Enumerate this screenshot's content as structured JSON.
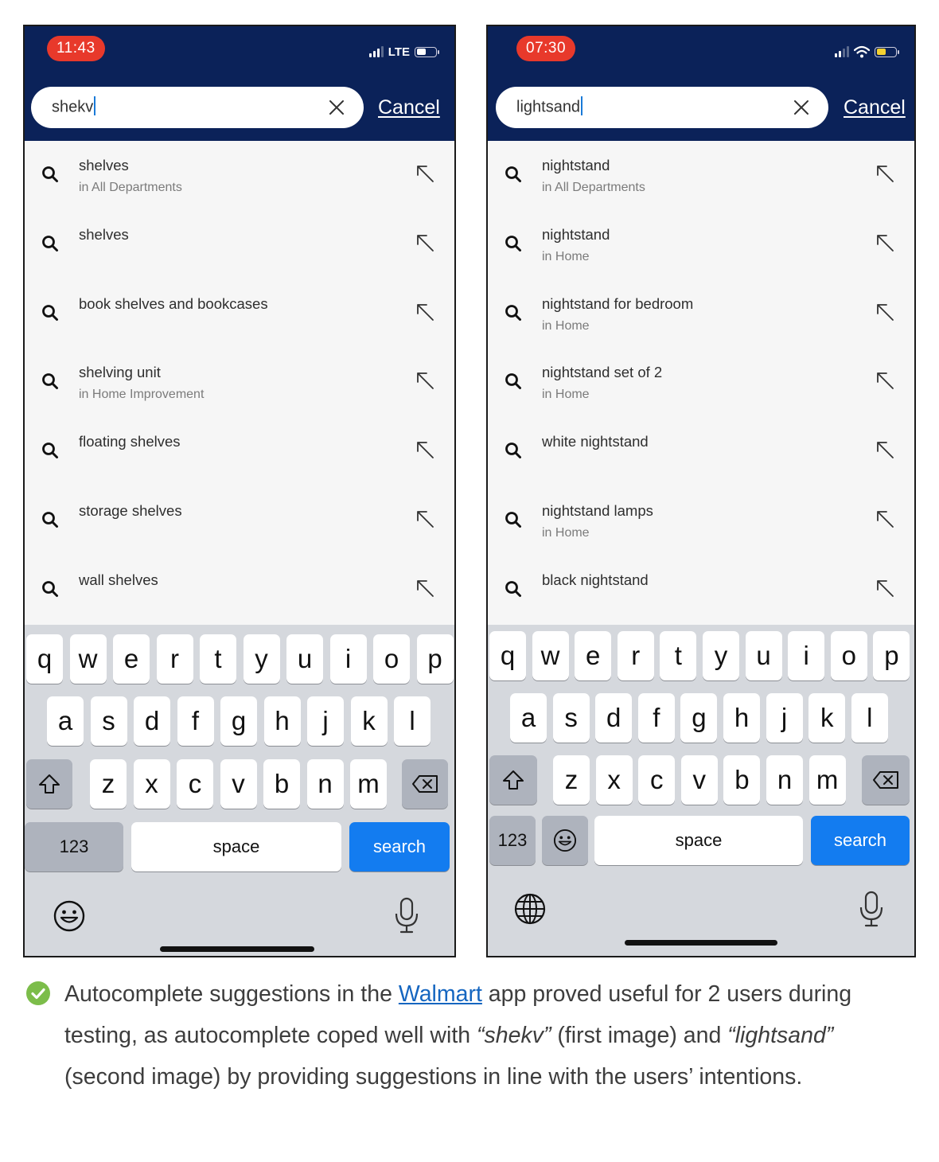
{
  "phones": [
    {
      "status": {
        "time": "11:43",
        "network": "LTE",
        "battery_color": "#ffffff"
      },
      "search": {
        "query": "shekv",
        "cancel_label": "Cancel"
      },
      "suggestions": [
        {
          "title": "shelves",
          "subtitle": "in All Departments"
        },
        {
          "title": "shelves",
          "subtitle": ""
        },
        {
          "title": "book shelves and bookcases",
          "subtitle": ""
        },
        {
          "title": "shelving unit",
          "subtitle": "in Home Improvement"
        },
        {
          "title": "floating shelves",
          "subtitle": ""
        },
        {
          "title": "storage shelves",
          "subtitle": ""
        },
        {
          "title": "wall shelves",
          "subtitle": ""
        }
      ],
      "keyboard": {
        "row1": [
          "q",
          "w",
          "e",
          "r",
          "t",
          "y",
          "u",
          "i",
          "o",
          "p"
        ],
        "row2": [
          "a",
          "s",
          "d",
          "f",
          "g",
          "h",
          "j",
          "k",
          "l"
        ],
        "row3": [
          "z",
          "x",
          "c",
          "v",
          "b",
          "n",
          "m"
        ],
        "numbers_label": "123",
        "space_label": "space",
        "search_label": "search"
      }
    },
    {
      "status": {
        "time": "07:30",
        "network": "",
        "battery_color": "#f3d030"
      },
      "search": {
        "query": "lightsand",
        "cancel_label": "Cancel"
      },
      "suggestions": [
        {
          "title": "nightstand",
          "subtitle": "in All Departments"
        },
        {
          "title": "nightstand",
          "subtitle": "in Home"
        },
        {
          "title": "nightstand for bedroom",
          "subtitle": "in Home"
        },
        {
          "title": "nightstand set of 2",
          "subtitle": "in Home"
        },
        {
          "title": "white nightstand",
          "subtitle": ""
        },
        {
          "title": "nightstand lamps",
          "subtitle": "in Home"
        },
        {
          "title": "black nightstand",
          "subtitle": ""
        }
      ],
      "keyboard": {
        "row1": [
          "q",
          "w",
          "e",
          "r",
          "t",
          "y",
          "u",
          "i",
          "o",
          "p"
        ],
        "row2": [
          "a",
          "s",
          "d",
          "f",
          "g",
          "h",
          "j",
          "k",
          "l"
        ],
        "row3": [
          "z",
          "x",
          "c",
          "v",
          "b",
          "n",
          "m"
        ],
        "numbers_label": "123",
        "space_label": "space",
        "search_label": "search"
      }
    }
  ],
  "caption": {
    "icon": "check-circle-icon",
    "icon_color": "#7cbd4a",
    "part1": "Autocomplete suggestions in the ",
    "link": "Walmart",
    "part2": " app proved useful for 2 users during testing, as autocomplete coped well with ",
    "query1": "“shekv”",
    "part3": " (first image) and ",
    "query2": "“lightsand”",
    "part4": " (second image) by providing suggestions in line with the users’ intentions."
  },
  "colors": {
    "header": "#0b2259",
    "time_pill": "#e8392b",
    "search_key": "#137cf0",
    "link": "#1566c0"
  }
}
